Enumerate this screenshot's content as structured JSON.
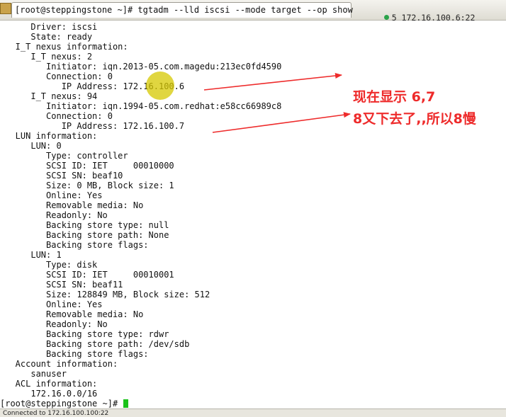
{
  "window": {
    "active_tab_label": "[root@steppingstone ~]# tgtadm --lld iscsi --mode target --op show",
    "second_tab_label": "5 172.16.100.6:22",
    "status_text": "Connected to 172.16.100.100:22"
  },
  "terminal": {
    "lines": [
      "      Driver: iscsi",
      "      State: ready",
      "   I_T nexus information:",
      "      I_T nexus: 2",
      "         Initiator: iqn.2013-05.com.magedu:213ec0fd4590",
      "         Connection: 0",
      "            IP Address: 172.16.100.6",
      "      I_T nexus: 94",
      "         Initiator: iqn.1994-05.com.redhat:e58cc66989c8",
      "         Connection: 0",
      "            IP Address: 172.16.100.7",
      "   LUN information:",
      "      LUN: 0",
      "         Type: controller",
      "         SCSI ID: IET     00010000",
      "         SCSI SN: beaf10",
      "         Size: 0 MB, Block size: 1",
      "         Online: Yes",
      "         Removable media: No",
      "         Readonly: No",
      "         Backing store type: null",
      "         Backing store path: None",
      "         Backing store flags:",
      "      LUN: 1",
      "         Type: disk",
      "         SCSI ID: IET     00010001",
      "         SCSI SN: beaf11",
      "         Size: 128849 MB, Block size: 512",
      "         Online: Yes",
      "         Removable media: No",
      "         Readonly: No",
      "         Backing store type: rdwr",
      "         Backing store path: /dev/sdb",
      "         Backing store flags:",
      "   Account information:",
      "      sanuser",
      "   ACL information:",
      "      172.16.0.0/16"
    ],
    "prompt": "[root@steppingstone ~]# "
  },
  "annotation": {
    "line1": "现在显示 6,7",
    "line2": "8又下去了,,所以8慢",
    "color": "#ee2b2b"
  },
  "colors": {
    "cursor": "#19c219",
    "cursor_highlight": "#d6c800"
  }
}
